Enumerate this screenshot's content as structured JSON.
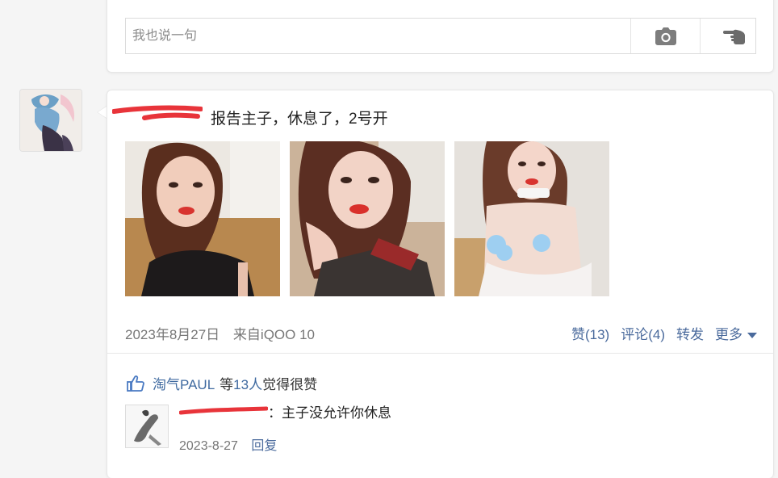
{
  "composer": {
    "placeholder": "我也说一句",
    "camera_icon": "camera-icon",
    "poke_icon": "hand-pointer-icon"
  },
  "post": {
    "author_redacted": true,
    "text": "报告主子，休息了，2号开",
    "date": "2023年8月27日",
    "source": "来自iQOO 10",
    "actions": {
      "like": "赞(13)",
      "comment": "评论(4)",
      "repost": "转发",
      "more": "更多"
    }
  },
  "likes": {
    "name": "淘气PAUL",
    "mid1": "等",
    "count": "13人",
    "suffix": "觉得很赞"
  },
  "comment": {
    "author_redacted": true,
    "text": "：主子没允许你休息",
    "date": "2023-8-27",
    "reply": "回复"
  },
  "colors": {
    "link": "#4a6a9c",
    "redaction": "#e8343a"
  }
}
